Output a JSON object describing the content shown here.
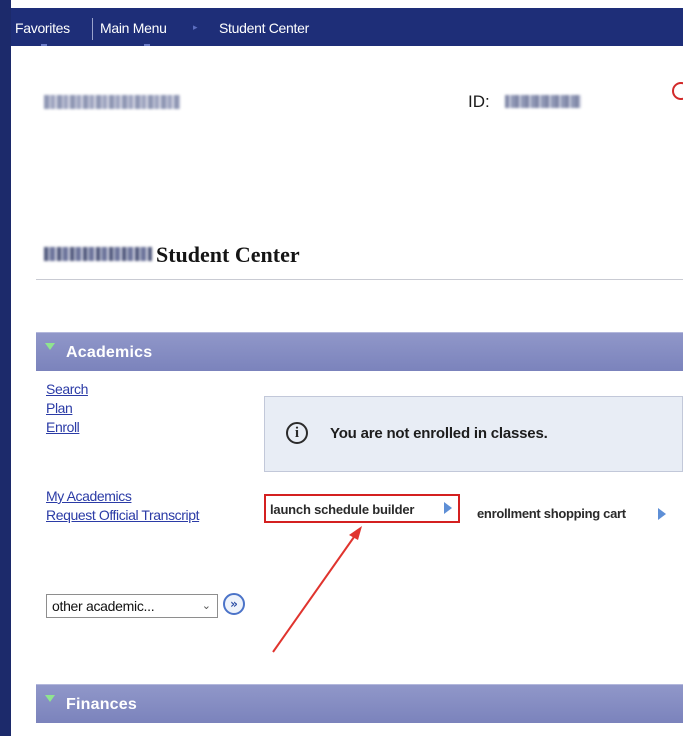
{
  "nav": {
    "favorites": "Favorites",
    "main_menu": "Main Menu",
    "student_center": "Student Center"
  },
  "header": {
    "id_label": "ID:",
    "page_title_suffix": "Student Center"
  },
  "academics": {
    "section_label": "Academics",
    "links": [
      "Search",
      "Plan",
      "Enroll",
      "My Academics",
      "Request Official Transcript"
    ],
    "enrollment_notice": "You are not enrolled in classes.",
    "launch_schedule_builder": "launch schedule builder",
    "enrollment_shopping_cart": "enrollment shopping cart",
    "other_academic_select": "other academic...",
    "go_button_glyph": "»"
  },
  "finances": {
    "section_label": "Finances"
  },
  "colors": {
    "nav_background": "#1e2e78",
    "section_header": "#8088c2",
    "link": "#2b3ba6",
    "highlight_border": "#d42020",
    "annotation_arrow": "#e0342e"
  },
  "icons": {
    "info": "info-circle-icon",
    "expand": "triangle-down-icon",
    "next": "triangle-right-icon",
    "go": "double-chevron-right-icon",
    "dropdown": "chevron-down-icon"
  }
}
